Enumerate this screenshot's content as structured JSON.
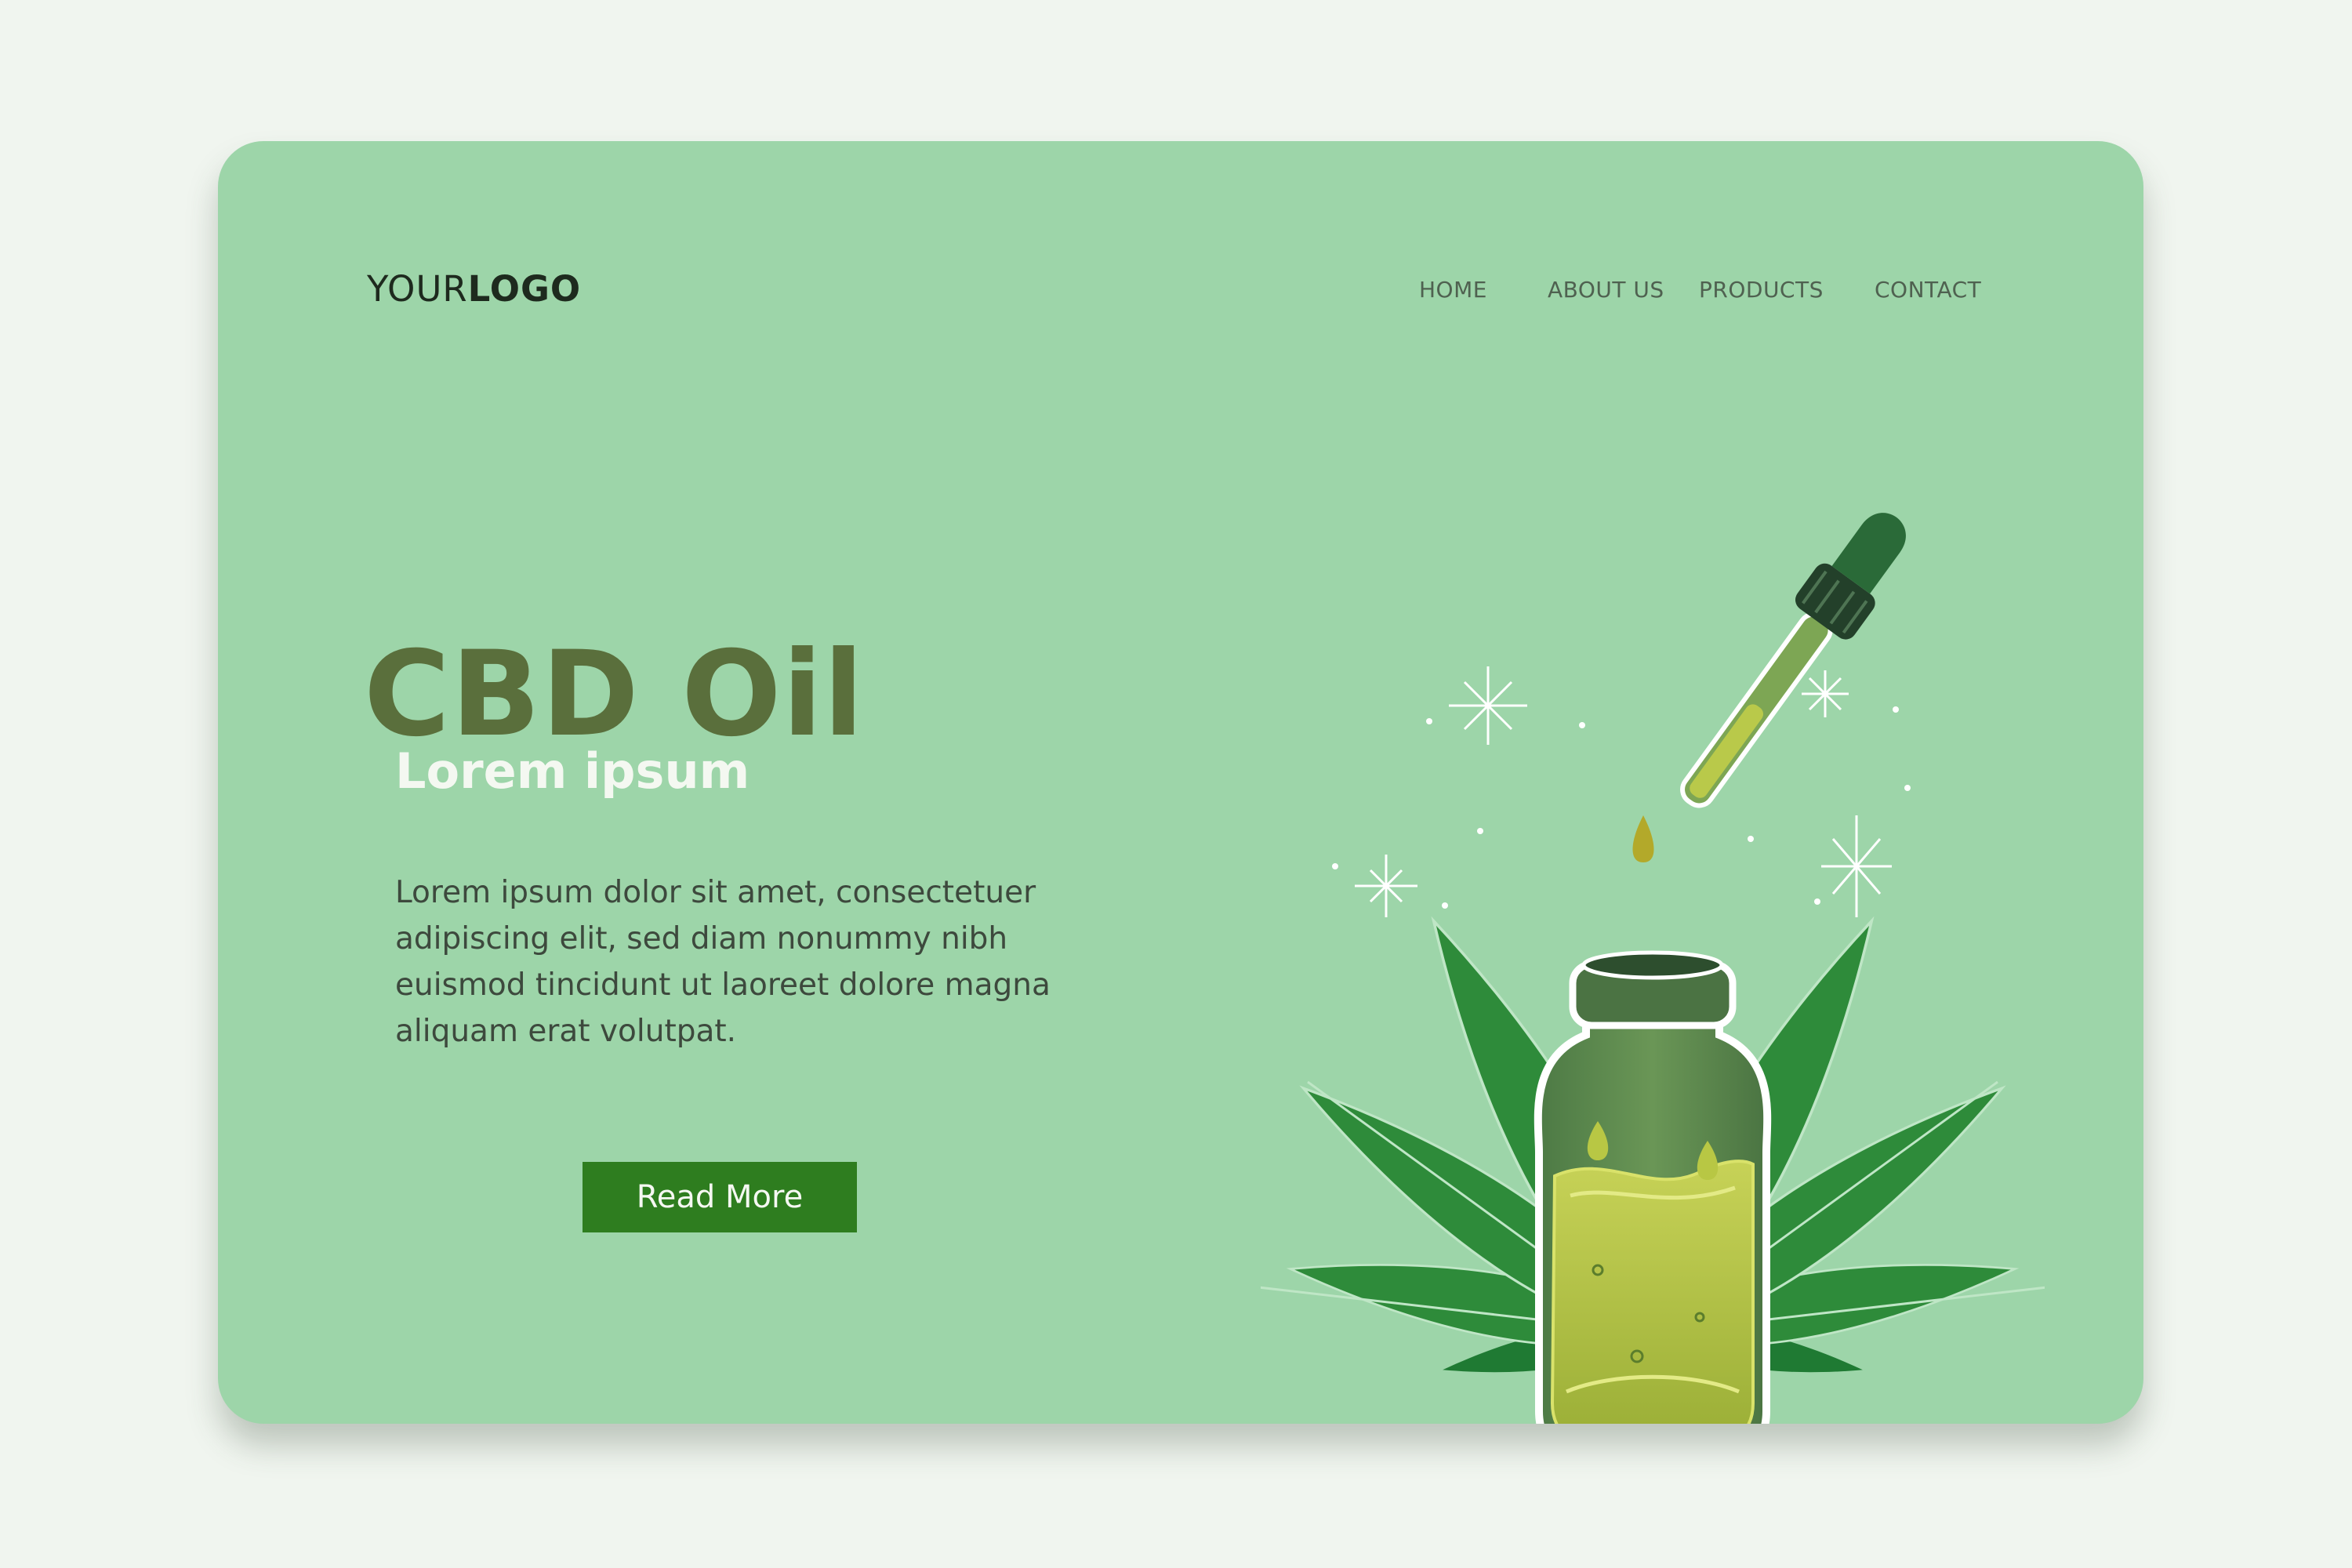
{
  "logo": {
    "prefix": "YOUR",
    "emphasis": "LOGO"
  },
  "nav": {
    "items": [
      {
        "label": "HOME"
      },
      {
        "label": "ABOUT US"
      },
      {
        "label": "PRODUCTS"
      },
      {
        "label": "CONTACT"
      }
    ]
  },
  "hero": {
    "title": "CBD Oil",
    "subtitle": "Lorem ipsum",
    "body": "Lorem ipsum dolor sit amet, consectetuer adipiscing elit, sed diam nonummy nibh euismod tincidunt ut laoreet dolore magna aliquam erat volutpat.",
    "cta_label": "Read More"
  },
  "illustration": {
    "icons": [
      "cannabis-leaf-icon",
      "oil-bottle-icon",
      "dropper-icon",
      "sparkle-icon"
    ]
  },
  "colors": {
    "page_background": "#f0f5ef",
    "card_background": "#9dd5a9",
    "title": "#5a6f3c",
    "subtitle": "#f4f8f1",
    "body_text": "#3d493d",
    "button": "#2e7d1f",
    "button_text": "#f5f8f2",
    "leaf": "#2e8b3a",
    "oil": "#b9c94a"
  }
}
